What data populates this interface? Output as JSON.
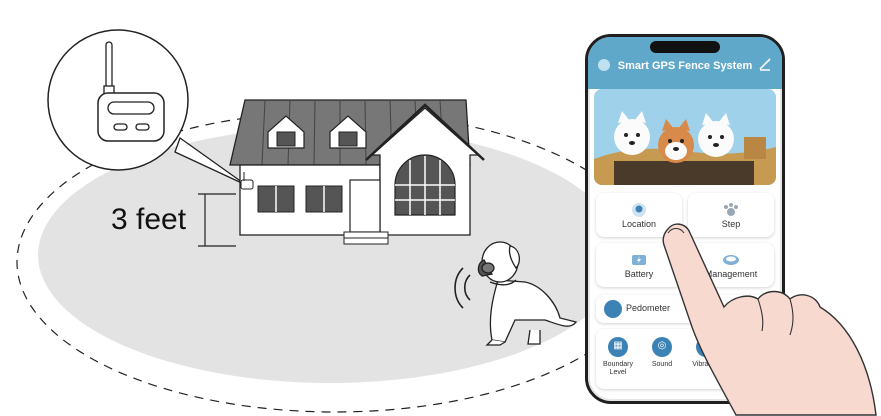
{
  "scene": {
    "height_label": "3 feet"
  },
  "app": {
    "title": "Smart GPS Fence System",
    "tiles": [
      {
        "label": "Location",
        "icon": "location-pin-icon"
      },
      {
        "label": "Step",
        "icon": "paw-icon"
      },
      {
        "label": "Battery",
        "icon": "battery-icon"
      },
      {
        "label": "Management",
        "icon": "management-icon"
      }
    ],
    "pedometer": {
      "label": "Pedometer",
      "icon": "paw-icon"
    },
    "bottom_items": [
      {
        "label": "Boundary Level",
        "icon": "boundary-icon"
      },
      {
        "label": "Sound",
        "icon": "sound-icon"
      },
      {
        "label": "Vibration",
        "icon": "vibration-icon"
      }
    ]
  },
  "colors": {
    "zone_fill": "#e3e3e3",
    "house_roof": "#777777",
    "app_header": "#5fa8c9",
    "accent_blue": "#3d82b5",
    "hand_skin": "#f7d9cf"
  }
}
